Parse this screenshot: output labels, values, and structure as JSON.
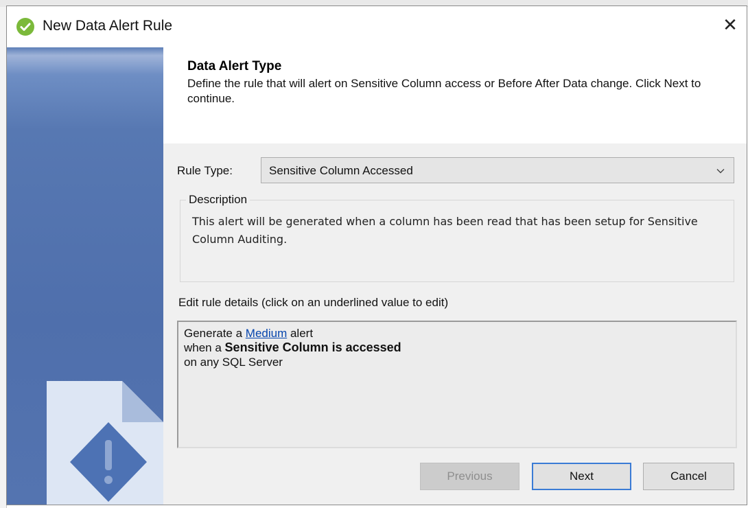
{
  "window": {
    "title": "New Data Alert Rule",
    "close_glyph": "✕",
    "icon": "green-check-circle-icon"
  },
  "header": {
    "title": "Data Alert Type",
    "description": "Define the rule that will alert on Sensitive Column access or Before After Data change. Click Next to continue."
  },
  "rule_type": {
    "label": "Rule Type:",
    "selected": "Sensitive Column Accessed"
  },
  "description_group": {
    "legend": "Description",
    "text": "This alert will be generated when a column has been read that has been setup for Sensitive Column Auditing."
  },
  "rule_details": {
    "label": "Edit rule details (click on an underlined value to edit)",
    "line1_prefix": "Generate a ",
    "line1_link": "Medium",
    "line1_suffix": " alert",
    "line2_prefix": "when a ",
    "line2_bold": "Sensitive Column is accessed",
    "line3": "on any SQL Server"
  },
  "buttons": {
    "previous": "Previous",
    "next": "Next",
    "cancel": "Cancel"
  },
  "colors": {
    "sidebar_blue": "#5474b0",
    "accent_blue": "#3a7bd5",
    "link_blue": "#0645ad",
    "check_green": "#7bb93a"
  }
}
